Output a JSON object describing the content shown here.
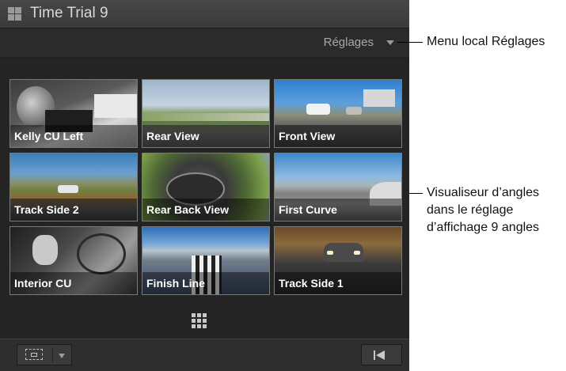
{
  "window": {
    "title": "Time Trial 9"
  },
  "settings_menu": {
    "label": "Réglages"
  },
  "angles": [
    {
      "label": "Kelly CU Left"
    },
    {
      "label": "Rear View"
    },
    {
      "label": "Front View"
    },
    {
      "label": "Track Side 2"
    },
    {
      "label": "Rear Back View"
    },
    {
      "label": "First Curve"
    },
    {
      "label": "Interior CU"
    },
    {
      "label": "Finish Line"
    },
    {
      "label": "Track Side 1"
    }
  ],
  "callouts": {
    "settings": "Menu local Réglages",
    "viewer_line1": "Visualiseur d’angles",
    "viewer_line2": "dans le réglage",
    "viewer_line3": "d’affichage 9 angles"
  },
  "icons": {
    "title": "viewer-grid-icon",
    "grid": "nine-grid-icon",
    "overlay": "overlay-icon",
    "prev": "go-to-previous-icon"
  }
}
